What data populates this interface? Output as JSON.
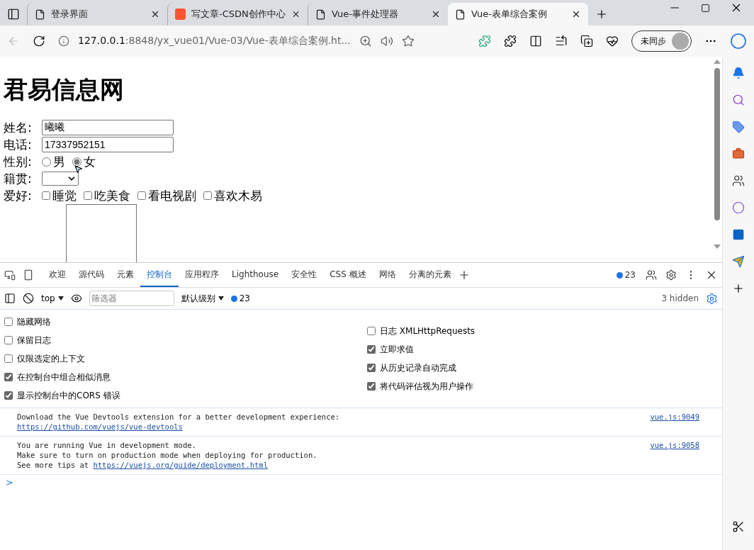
{
  "tabs": [
    {
      "title": "登录界面",
      "kind": "page",
      "selected": false
    },
    {
      "title": "写文章-CSDN创作中心",
      "kind": "csdn",
      "selected": false
    },
    {
      "title": "Vue-事件处理器",
      "kind": "page",
      "selected": false
    },
    {
      "title": "Vue-表单综合案例",
      "kind": "page",
      "selected": true
    }
  ],
  "address": {
    "host": "127.0.0.1",
    "rest": ":8848/yx_vue01/Vue-03/Vue-表单综合案例.ht..."
  },
  "profile": {
    "label": "未同步"
  },
  "page": {
    "heading": "君易信息网",
    "fields": [
      {
        "kind": "text",
        "label": "姓名:",
        "value": "曦曦"
      },
      {
        "kind": "text",
        "label": "电话:",
        "value": "17337952151"
      },
      {
        "kind": "radio",
        "label": "性别:",
        "options": [
          {
            "label": "男",
            "selected": false
          },
          {
            "label": "女",
            "selected": true
          }
        ]
      },
      {
        "kind": "select",
        "label": "籍贯:"
      },
      {
        "kind": "checkbox",
        "label": "爱好:",
        "options": [
          {
            "label": "睡觉",
            "checked": false
          },
          {
            "label": "吃美食",
            "checked": false
          },
          {
            "label": "看电视剧",
            "checked": false
          },
          {
            "label": "喜欢木易",
            "checked": false
          }
        ]
      },
      {
        "kind": "textarea"
      }
    ]
  },
  "devtools": {
    "tabs": [
      {
        "label": "欢迎",
        "selected": false
      },
      {
        "label": "源代码",
        "selected": false
      },
      {
        "label": "元素",
        "selected": false
      },
      {
        "label": "控制台",
        "selected": true
      },
      {
        "label": "应用程序",
        "selected": false
      },
      {
        "label": "Lighthouse",
        "selected": false
      },
      {
        "label": "安全性",
        "selected": false
      },
      {
        "label": "CSS 概述",
        "selected": false
      },
      {
        "label": "网络",
        "selected": false
      },
      {
        "label": "分离的元素",
        "selected": false
      }
    ],
    "issues_count": "23",
    "toolbar": {
      "context": "top",
      "filter_placeholder": "筛选器",
      "level": "默认级别",
      "issues_count": "23",
      "hidden": "3 hidden"
    },
    "settings_left": [
      {
        "label": "隐藏网络",
        "checked": false
      },
      {
        "label": "保留日志",
        "checked": false
      },
      {
        "label": "仅限选定的上下文",
        "checked": false
      },
      {
        "label": "在控制台中组合相似消息",
        "checked": true
      },
      {
        "label": "显示控制台中的CORS 错误",
        "checked": true
      }
    ],
    "settings_right": [
      {
        "label": "日志 XMLHttpRequests",
        "checked": false
      },
      {
        "label": "立即求值",
        "checked": true
      },
      {
        "label": "从历史记录自动完成",
        "checked": true
      },
      {
        "label": "将代码评估视为用户操作",
        "checked": true
      }
    ],
    "messages": [
      {
        "source": "vue.js:9049",
        "lines": [
          [
            {
              "text": "Download the Vue Devtools extension for a better development experience:"
            }
          ],
          [
            {
              "text": "https://github.com/vuejs/vue-devtools",
              "link": true
            }
          ]
        ]
      },
      {
        "source": "vue.js:9058",
        "lines": [
          [
            {
              "text": "You are running Vue in development mode."
            }
          ],
          [
            {
              "text": "Make sure to turn on production mode when deploying for production."
            }
          ],
          [
            {
              "text": "See more tips at "
            },
            {
              "text": "https://vuejs.org/guide/deployment.html",
              "link": true
            }
          ]
        ]
      }
    ],
    "prompt": ">"
  }
}
